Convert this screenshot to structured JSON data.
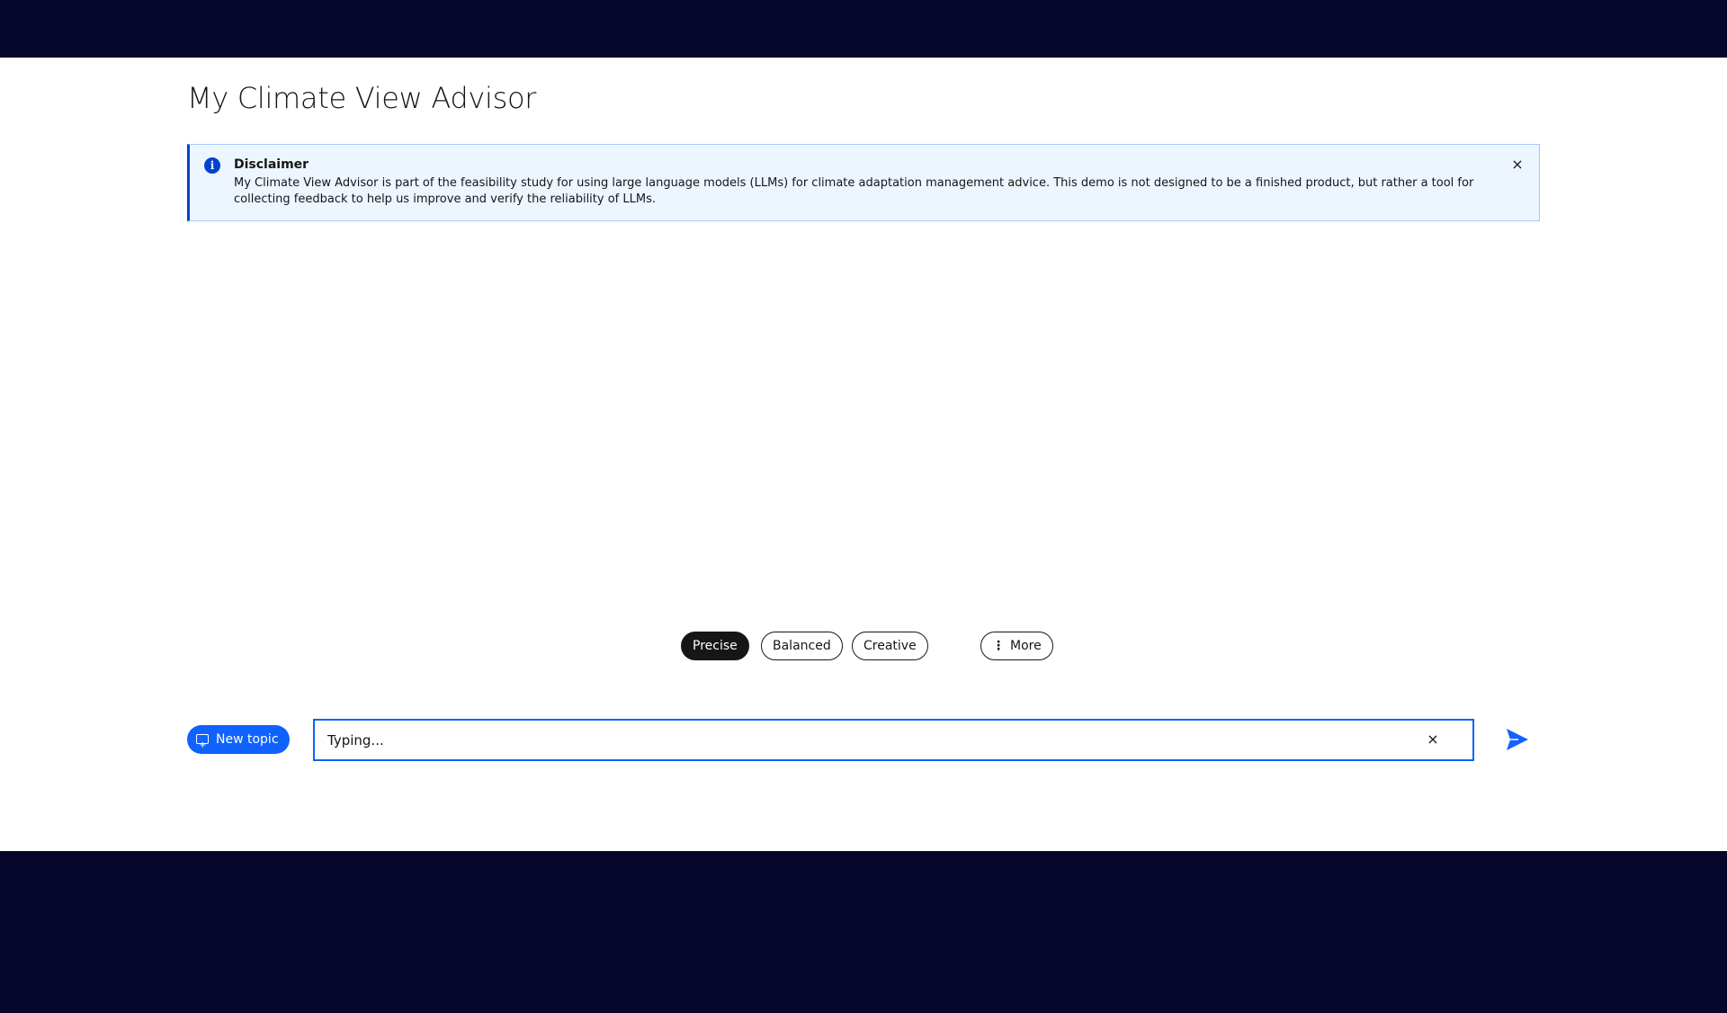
{
  "app": {
    "title": "My Climate View Advisor"
  },
  "notice": {
    "title": "Disclaimer",
    "body": "My Climate View Advisor is part of the feasibility study for using large language models (LLMs) for climate adaptation management advice. This demo is not designed to be a finished product, but rather a tool for collecting feedback to help us improve and verify the reliability of LLMs.",
    "info_icon": "i",
    "close_icon": "×"
  },
  "modes": {
    "items": [
      "Precise",
      "Balanced",
      "Creative"
    ],
    "selected": "Precise",
    "more_label": "More",
    "more_icon": "⋮"
  },
  "composer": {
    "new_topic_label": "New topic",
    "placeholder": "Typing...",
    "clear_icon": "×"
  },
  "colors": {
    "accent": "#0f62fe",
    "header_bg": "#06072b",
    "notice_bg": "#edf5ff",
    "notice_border": "#0043ce"
  }
}
